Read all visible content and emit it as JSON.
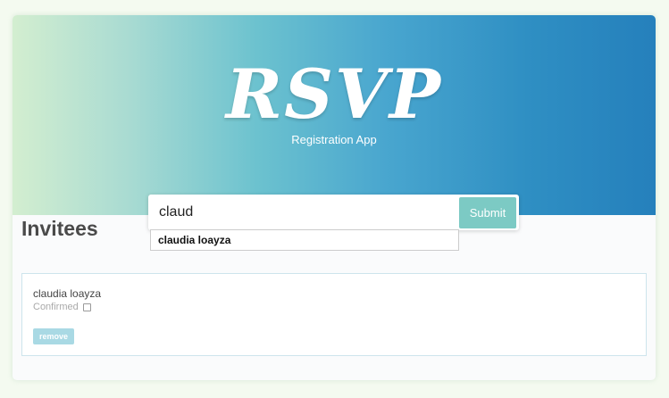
{
  "header": {
    "logo": "RSVP",
    "subtitle": "Registration App"
  },
  "form": {
    "input_value": "claud",
    "submit_label": "Submit"
  },
  "autocomplete": {
    "suggestions": [
      "claudia loayza"
    ]
  },
  "main": {
    "title": "Invitees",
    "invitees": [
      {
        "name": "claudia loayza",
        "status_label": "Confirmed",
        "confirmed": false,
        "remove_label": "remove"
      }
    ]
  },
  "colors": {
    "submit_button": "#7ccac4",
    "remove_button": "#a9d9e4",
    "header_gradient_start": "#d3eed0",
    "header_gradient_end": "#2580bc"
  }
}
